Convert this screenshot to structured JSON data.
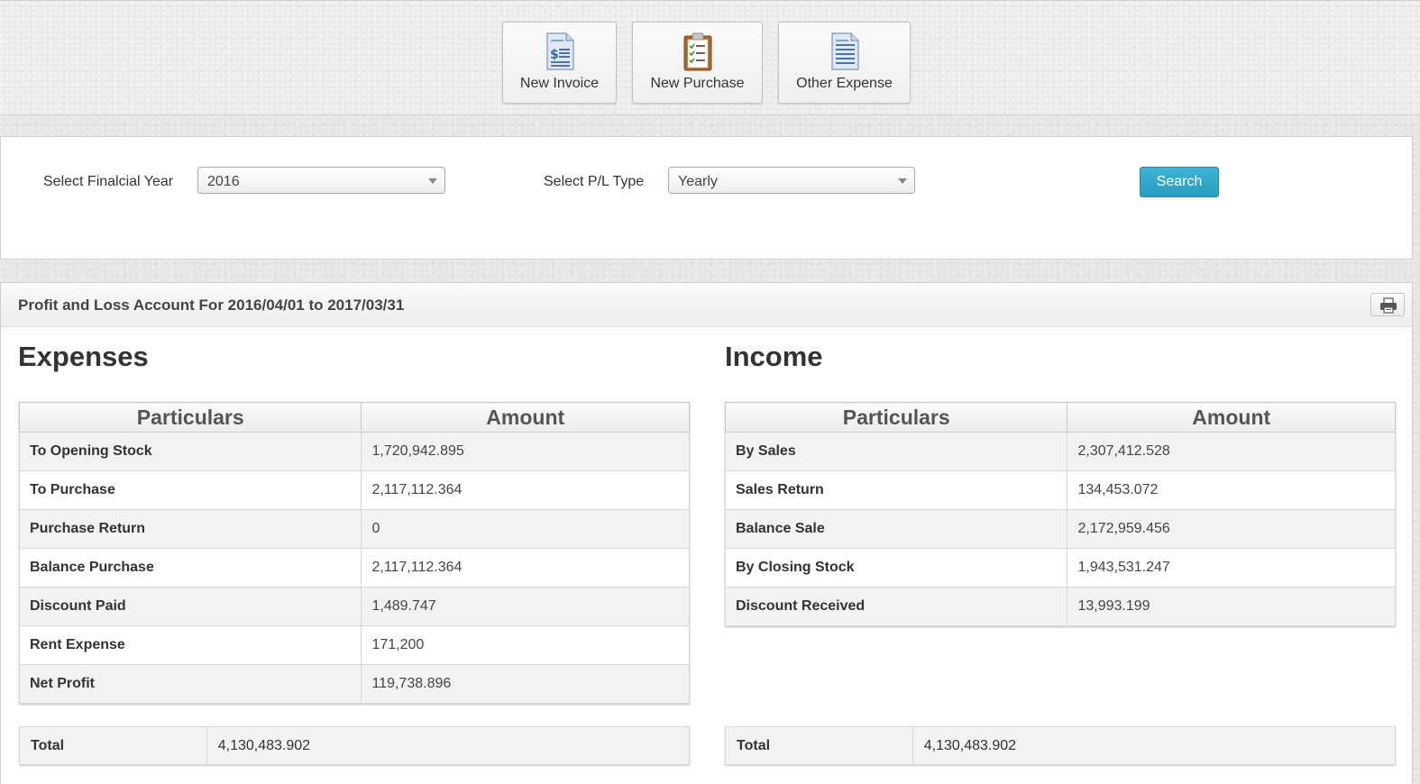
{
  "toolbar": {
    "new_invoice": {
      "label": "New Invoice",
      "icon": "invoice-icon"
    },
    "new_purchase": {
      "label": "New Purchase",
      "icon": "clipboard-checklist-icon"
    },
    "other_expense": {
      "label": "Other Expense",
      "icon": "document-icon"
    }
  },
  "filter": {
    "year_label": "Select Finalcial Year",
    "year_value": "2016",
    "type_label": "Select P/L Type",
    "type_value": "Yearly",
    "search_label": "Search",
    "accent_color": "#2fa4c8"
  },
  "report": {
    "title": "Profit and Loss Account For 2016/04/01 to 2017/03/31",
    "print_icon": "printer-icon",
    "expenses": {
      "heading": "Expenses",
      "col_particulars": "Particulars",
      "col_amount": "Amount",
      "rows": [
        {
          "particular": "To Opening Stock",
          "amount": "1,720,942.895"
        },
        {
          "particular": "To Purchase",
          "amount": "2,117,112.364"
        },
        {
          "particular": "Purchase Return",
          "amount": "0"
        },
        {
          "particular": "Balance Purchase",
          "amount": "2,117,112.364"
        },
        {
          "particular": "Discount Paid",
          "amount": "1,489.747"
        },
        {
          "particular": "Rent Expense",
          "amount": "171,200"
        },
        {
          "particular": "Net Profit",
          "amount": "119,738.896"
        }
      ],
      "total_label": "Total",
      "total_value": "4,130,483.902"
    },
    "income": {
      "heading": "Income",
      "col_particulars": "Particulars",
      "col_amount": "Amount",
      "rows": [
        {
          "particular": "By Sales",
          "amount": "2,307,412.528"
        },
        {
          "particular": "Sales Return",
          "amount": "134,453.072"
        },
        {
          "particular": "Balance Sale",
          "amount": "2,172,959.456"
        },
        {
          "particular": "By Closing Stock",
          "amount": "1,943,531.247"
        },
        {
          "particular": "Discount Received",
          "amount": "13,993.199"
        }
      ],
      "total_label": "Total",
      "total_value": "4,130,483.902"
    }
  }
}
